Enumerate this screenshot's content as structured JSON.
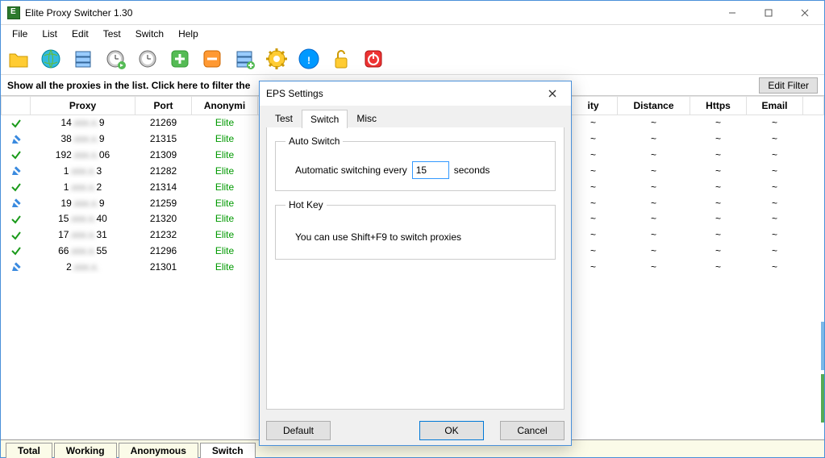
{
  "window": {
    "title": "Elite Proxy Switcher 1.30",
    "min_tooltip": "Minimize",
    "max_tooltip": "Maximize",
    "close_tooltip": "Close"
  },
  "menu": [
    "File",
    "List",
    "Edit",
    "Test",
    "Switch",
    "Help"
  ],
  "filter": {
    "text": "Show all the proxies in the list. Click here to filter the",
    "edit_filter": "Edit Filter"
  },
  "columns": [
    "",
    "Proxy",
    "Port",
    "Anonymi",
    "ity",
    "Distance",
    "Https",
    "Email",
    ""
  ],
  "rows": [
    {
      "status": "ok",
      "proxy_a": "14",
      "proxy_b": "9",
      "port": "21269",
      "anon": "Elite",
      "city": "~",
      "dist": "~",
      "https": "~",
      "email": "~"
    },
    {
      "status": "pencil",
      "proxy_a": "38",
      "proxy_b": "9",
      "port": "21315",
      "anon": "Elite",
      "city": "~",
      "dist": "~",
      "https": "~",
      "email": "~"
    },
    {
      "status": "ok",
      "proxy_a": "192",
      "proxy_b": "06",
      "port": "21309",
      "anon": "Elite",
      "city": "~",
      "dist": "~",
      "https": "~",
      "email": "~"
    },
    {
      "status": "pencil",
      "proxy_a": "1",
      "proxy_b": "3",
      "port": "21282",
      "anon": "Elite",
      "city": "~",
      "dist": "~",
      "https": "~",
      "email": "~"
    },
    {
      "status": "ok",
      "proxy_a": "1",
      "proxy_b": "2",
      "port": "21314",
      "anon": "Elite",
      "city": "~",
      "dist": "~",
      "https": "~",
      "email": "~"
    },
    {
      "status": "pencil",
      "proxy_a": "19",
      "proxy_b": "9",
      "port": "21259",
      "anon": "Elite",
      "city": "~",
      "dist": "~",
      "https": "~",
      "email": "~"
    },
    {
      "status": "ok",
      "proxy_a": "15",
      "proxy_b": "40",
      "port": "21320",
      "anon": "Elite",
      "city": "~",
      "dist": "~",
      "https": "~",
      "email": "~"
    },
    {
      "status": "ok",
      "proxy_a": "17",
      "proxy_b": "31",
      "port": "21232",
      "anon": "Elite",
      "city": "~",
      "dist": "~",
      "https": "~",
      "email": "~"
    },
    {
      "status": "ok",
      "proxy_a": "66",
      "proxy_b": "55",
      "port": "21296",
      "anon": "Elite",
      "city": "~",
      "dist": "~",
      "https": "~",
      "email": "~"
    },
    {
      "status": "pencil",
      "proxy_a": "2",
      "proxy_b": "",
      "port": "21301",
      "anon": "Elite",
      "city": "~",
      "dist": "~",
      "https": "~",
      "email": "~"
    }
  ],
  "bottom_tabs": [
    "Total",
    "Working",
    "Anonymous",
    "Switch"
  ],
  "dialog": {
    "title": "EPS Settings",
    "tabs": [
      "Test",
      "Switch",
      "Misc"
    ],
    "active_tab": 1,
    "auto_switch_legend": "Auto Switch",
    "auto_switch_label_pre": "Automatic switching every",
    "auto_switch_value": "15",
    "auto_switch_label_post": "seconds",
    "hotkey_legend": "Hot Key",
    "hotkey_text": "You can use Shift+F9 to switch proxies",
    "btn_default": "Default",
    "btn_ok": "OK",
    "btn_cancel": "Cancel"
  },
  "icons": {
    "folder": "folder-icon",
    "globe": "globe-icon",
    "servers": "servers-icon",
    "clock-plus": "clock-plus-icon",
    "clock-pause": "clock-pause-icon",
    "add": "add-icon",
    "remove": "remove-icon",
    "servers2": "servers-alt-icon",
    "gear": "gear-icon",
    "info": "info-icon",
    "lock": "lock-open-icon",
    "power": "power-icon"
  }
}
